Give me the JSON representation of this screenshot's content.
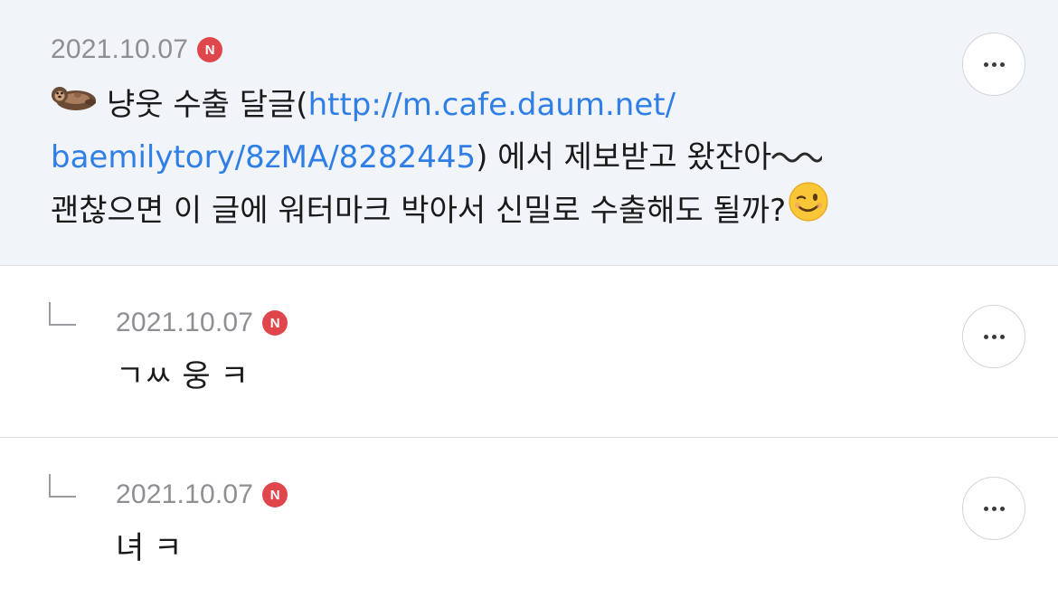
{
  "comments": [
    {
      "date": "2021.10.07",
      "badge": "N",
      "emoji_lead": "otter-icon",
      "text_before_link": "냥웃 수출 달글(",
      "link_text": "http://m.cafe.daum.net/baemilytory/8zMA/8282445",
      "link_line1": "http://m.cafe.daum.net/",
      "link_line2": "baemilytory/8zMA/8282445",
      "text_after_link": ") 에서 제보받고 왔잔아",
      "wavy_emoji": "wavy-dash-icon",
      "text_line3": "괜찮으면 이 글에 워터마크 박아서 신밀로 수출해도 될까?",
      "emoji_trail": "winking-face-icon",
      "more_icon": "more-options-icon"
    },
    {
      "date": "2021.10.07",
      "badge": "N",
      "text": "ㄱㅆ 웅 ㅋ",
      "more_icon": "more-options-icon"
    },
    {
      "date": "2021.10.07",
      "badge": "N",
      "text": "녀 ㅋ",
      "more_icon": "more-options-icon"
    }
  ],
  "colors": {
    "main_bg": "#f1f4f9",
    "link": "#2f7fe6",
    "badge": "#e0474c",
    "date": "#8e8f94"
  }
}
